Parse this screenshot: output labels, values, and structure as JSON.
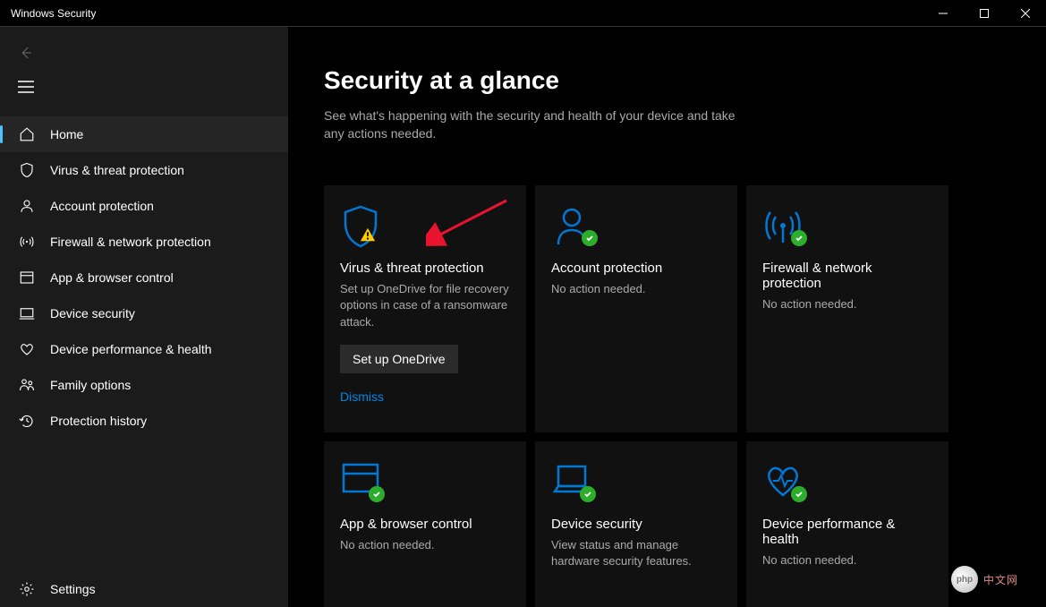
{
  "window": {
    "title": "Windows Security"
  },
  "sidebar": {
    "items": [
      {
        "label": "Home"
      },
      {
        "label": "Virus & threat protection"
      },
      {
        "label": "Account protection"
      },
      {
        "label": "Firewall & network protection"
      },
      {
        "label": "App & browser control"
      },
      {
        "label": "Device security"
      },
      {
        "label": "Device performance & health"
      },
      {
        "label": "Family options"
      },
      {
        "label": "Protection history"
      }
    ],
    "settings_label": "Settings"
  },
  "main": {
    "title": "Security at a glance",
    "subtitle": "See what's happening with the security and health of your device and take any actions needed.",
    "cards": {
      "virus": {
        "title": "Virus & threat protection",
        "desc": "Set up OneDrive for file recovery options in case of a ransomware attack.",
        "button": "Set up OneDrive",
        "dismiss": "Dismiss"
      },
      "account": {
        "title": "Account protection",
        "desc": "No action needed."
      },
      "firewall": {
        "title": "Firewall & network protection",
        "desc": "No action needed."
      },
      "app": {
        "title": "App & browser control",
        "desc": "No action needed."
      },
      "device": {
        "title": "Device security",
        "desc": "View status and manage hardware security features."
      },
      "perf": {
        "title": "Device performance & health",
        "desc": "No action needed."
      }
    }
  },
  "watermark": {
    "logo": "php",
    "text": "中文网"
  }
}
